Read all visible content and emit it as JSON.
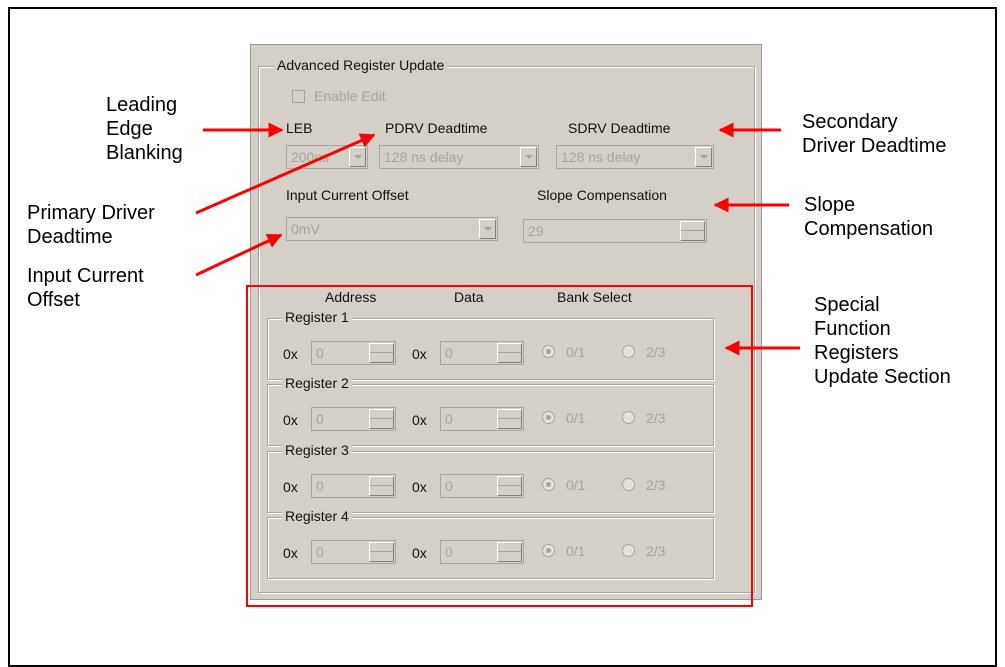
{
  "dialog": {
    "group_title": "Advanced Register Update",
    "enable_edit_label": "Enable Edit",
    "leb": {
      "label": "LEB",
      "value": "200ns"
    },
    "pdrv": {
      "label": "PDRV Deadtime",
      "value": "128 ns delay"
    },
    "sdrv": {
      "label": "SDRV Deadtime",
      "value": "128 ns delay"
    },
    "input_offset": {
      "label": "Input Current Offset",
      "value": "0mV"
    },
    "slope": {
      "label": "Slope Compensation",
      "value": "29"
    },
    "headers": {
      "address": "Address",
      "data": "Data",
      "bank_select": "Bank Select"
    },
    "registers": [
      {
        "title": "Register 1",
        "prefix1": "0x",
        "addr": "0",
        "prefix2": "0x",
        "data": "0",
        "opt1": "0/1",
        "opt2": "2/3"
      },
      {
        "title": "Register 2",
        "prefix1": "0x",
        "addr": "0",
        "prefix2": "0x",
        "data": "0",
        "opt1": "0/1",
        "opt2": "2/3"
      },
      {
        "title": "Register 3",
        "prefix1": "0x",
        "addr": "0",
        "prefix2": "0x",
        "data": "0",
        "opt1": "0/1",
        "opt2": "2/3"
      },
      {
        "title": "Register 4",
        "prefix1": "0x",
        "addr": "0",
        "prefix2": "0x",
        "data": "0",
        "opt1": "0/1",
        "opt2": "2/3"
      }
    ]
  },
  "annotations": {
    "leading_edge": [
      "Leading",
      "Edge",
      "Blanking"
    ],
    "primary_driver": [
      "Primary Driver",
      "Deadtime"
    ],
    "input_current": [
      "Input Current",
      "Offset"
    ],
    "secondary_driver": [
      "Secondary",
      "Driver Deadtime"
    ],
    "slope_comp": [
      "Slope",
      "Compensation"
    ],
    "sfr": [
      "Special",
      "Function",
      "Registers",
      "Update Section"
    ]
  },
  "colors": {
    "annotation_red": "#ff0000",
    "panel": "#d4d0c8"
  }
}
